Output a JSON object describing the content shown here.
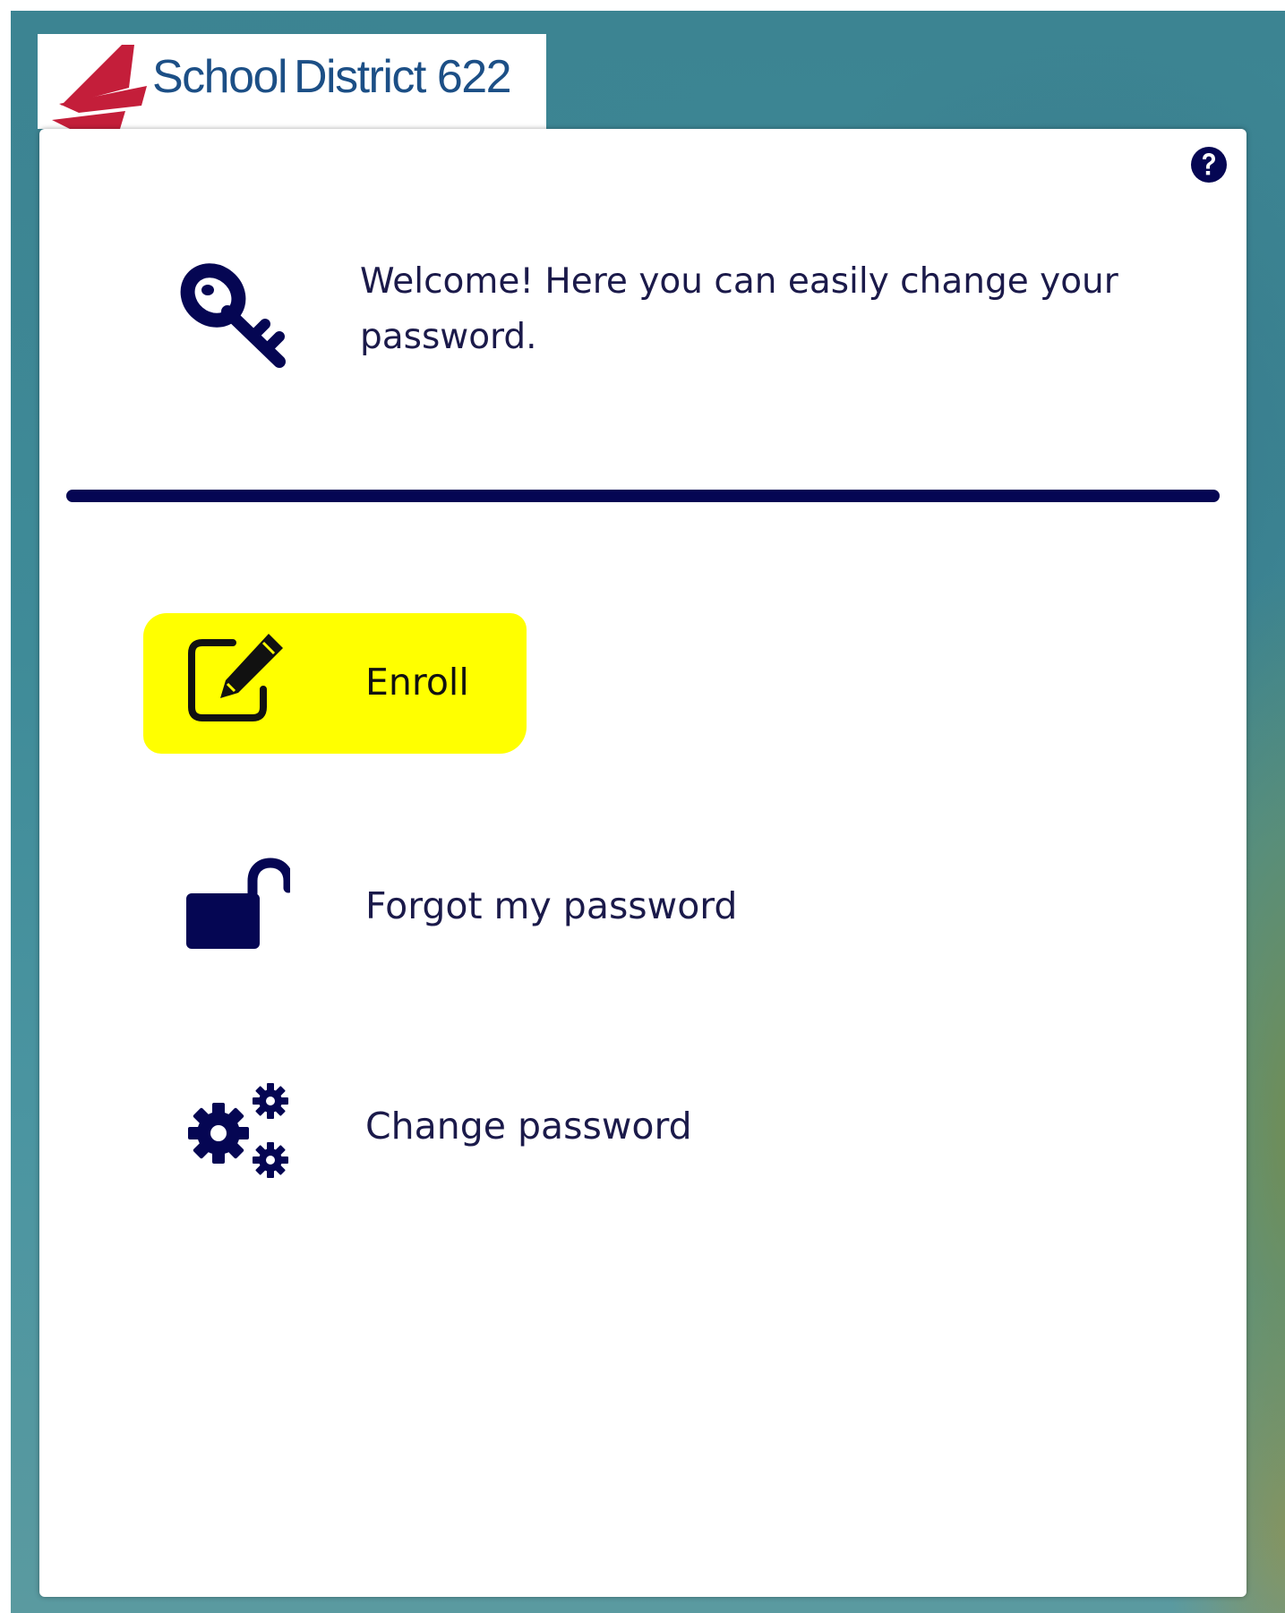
{
  "logo": {
    "text_light": "School",
    "text_bold": "District 622",
    "brand_color": "#1c4f86",
    "mark_color": "#c41e3a"
  },
  "help": {
    "icon": "question-circle-icon"
  },
  "welcome": {
    "icon": "key-icon",
    "message": "Welcome! Here you can easily change your password."
  },
  "options": {
    "enroll": {
      "label": "Enroll",
      "icon": "edit-square-icon",
      "highlighted": true
    },
    "forgot": {
      "label": "Forgot my password",
      "icon": "unlock-icon"
    },
    "change": {
      "label": "Change password",
      "icon": "gears-icon"
    }
  },
  "colors": {
    "primary": "#050653",
    "text": "#1b1a4a",
    "highlight": "#ffff00"
  }
}
